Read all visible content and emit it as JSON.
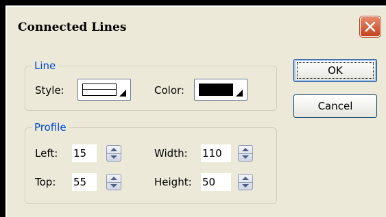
{
  "dialog": {
    "title": "Connected Lines",
    "close_icon": "close-x-icon"
  },
  "line_group": {
    "legend": "Line",
    "style_label": "Style:",
    "color_label": "Color:",
    "color_value": "#000000"
  },
  "profile_group": {
    "legend": "Profile",
    "left_label": "Left:",
    "left_value": "15",
    "top_label": "Top:",
    "top_value": "55",
    "width_label": "Width:",
    "width_value": "110",
    "height_label": "Height:",
    "height_value": "50"
  },
  "buttons": {
    "ok": "OK",
    "cancel": "Cancel"
  },
  "colors": {
    "legend_accent": "#0046d5",
    "dialog_bg": "#ece9d8",
    "close_red": "#c4411f"
  }
}
